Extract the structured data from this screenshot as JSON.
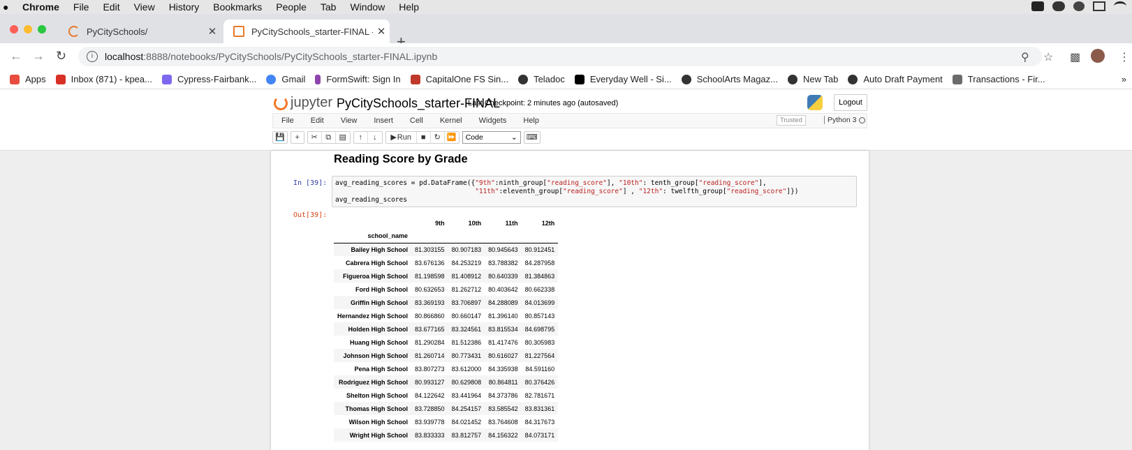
{
  "mac_menu": {
    "app": "Chrome",
    "items": [
      "File",
      "Edit",
      "View",
      "History",
      "Bookmarks",
      "People",
      "Tab",
      "Window",
      "Help"
    ]
  },
  "tabs": [
    {
      "title": "PyCitySchools/",
      "active": false
    },
    {
      "title": "PyCitySchools_starter-FINAL -",
      "active": true
    }
  ],
  "address": {
    "host": "localhost",
    "path": ":8888/notebooks/PyCitySchools/PyCitySchools_starter-FINAL.ipynb"
  },
  "bookmarks": [
    {
      "label": "Apps",
      "color": "#e74c3c"
    },
    {
      "label": "Inbox (871) - kpea...",
      "color": "#d93025"
    },
    {
      "label": "Cypress-Fairbank...",
      "color": "#7b68ee"
    },
    {
      "label": "Gmail",
      "color": "#4285f4"
    },
    {
      "label": "FormSwift: Sign In",
      "color": "#8e44ad"
    },
    {
      "label": "CapitalOne FS Sin...",
      "color": "#c0392b"
    },
    {
      "label": "Teladoc",
      "color": "#333333"
    },
    {
      "label": "Everyday Well - Si...",
      "color": "#000000"
    },
    {
      "label": "SchoolArts Magaz...",
      "color": "#333333"
    },
    {
      "label": "New Tab",
      "color": "#333333"
    },
    {
      "label": "Auto Draft Payment",
      "color": "#333333"
    },
    {
      "label": "Transactions - Fir...",
      "color": "#6b6b6b"
    }
  ],
  "jupyter": {
    "logo_text": "jupyter",
    "notebook_title": "PyCitySchools_starter-FINAL",
    "checkpoint": "Last Checkpoint: 2 minutes ago  (autosaved)",
    "logout_label": "Logout",
    "menu": [
      "File",
      "Edit",
      "View",
      "Insert",
      "Cell",
      "Kernel",
      "Widgets",
      "Help"
    ],
    "trusted": "Trusted",
    "kernel_name": "Python 3",
    "run_label": "Run",
    "cell_type": "Code"
  },
  "cell": {
    "heading": "Reading Score by Grade",
    "in_prompt": "In [39]:",
    "out_prompt": "Out[39]:"
  },
  "table": {
    "columns": [
      "9th",
      "10th",
      "11th",
      "12th"
    ],
    "index_name": "school_name",
    "rows": [
      {
        "school": "Bailey High School",
        "values": [
          "81.303155",
          "80.907183",
          "80.945643",
          "80.912451"
        ]
      },
      {
        "school": "Cabrera High School",
        "values": [
          "83.676136",
          "84.253219",
          "83.788382",
          "84.287958"
        ]
      },
      {
        "school": "Figueroa High School",
        "values": [
          "81.198598",
          "81.408912",
          "80.640339",
          "81.384863"
        ]
      },
      {
        "school": "Ford High School",
        "values": [
          "80.632653",
          "81.262712",
          "80.403642",
          "80.662338"
        ]
      },
      {
        "school": "Griffin High School",
        "values": [
          "83.369193",
          "83.706897",
          "84.288089",
          "84.013699"
        ]
      },
      {
        "school": "Hernandez High School",
        "values": [
          "80.866860",
          "80.660147",
          "81.396140",
          "80.857143"
        ]
      },
      {
        "school": "Holden High School",
        "values": [
          "83.677165",
          "83.324561",
          "83.815534",
          "84.698795"
        ]
      },
      {
        "school": "Huang High School",
        "values": [
          "81.290284",
          "81.512386",
          "81.417476",
          "80.305983"
        ]
      },
      {
        "school": "Johnson High School",
        "values": [
          "81.260714",
          "80.773431",
          "80.616027",
          "81.227564"
        ]
      },
      {
        "school": "Pena High School",
        "values": [
          "83.807273",
          "83.612000",
          "84.335938",
          "84.591160"
        ]
      },
      {
        "school": "Rodriguez High School",
        "values": [
          "80.993127",
          "80.629808",
          "80.864811",
          "80.376426"
        ]
      },
      {
        "school": "Shelton High School",
        "values": [
          "84.122642",
          "83.441964",
          "84.373786",
          "82.781671"
        ]
      },
      {
        "school": "Thomas High School",
        "values": [
          "83.728850",
          "84.254157",
          "83.585542",
          "83.831361"
        ]
      },
      {
        "school": "Wilson High School",
        "values": [
          "83.939778",
          "84.021452",
          "83.764608",
          "84.317673"
        ]
      },
      {
        "school": "Wright High School",
        "values": [
          "83.833333",
          "83.812757",
          "84.156322",
          "84.073171"
        ]
      }
    ]
  }
}
